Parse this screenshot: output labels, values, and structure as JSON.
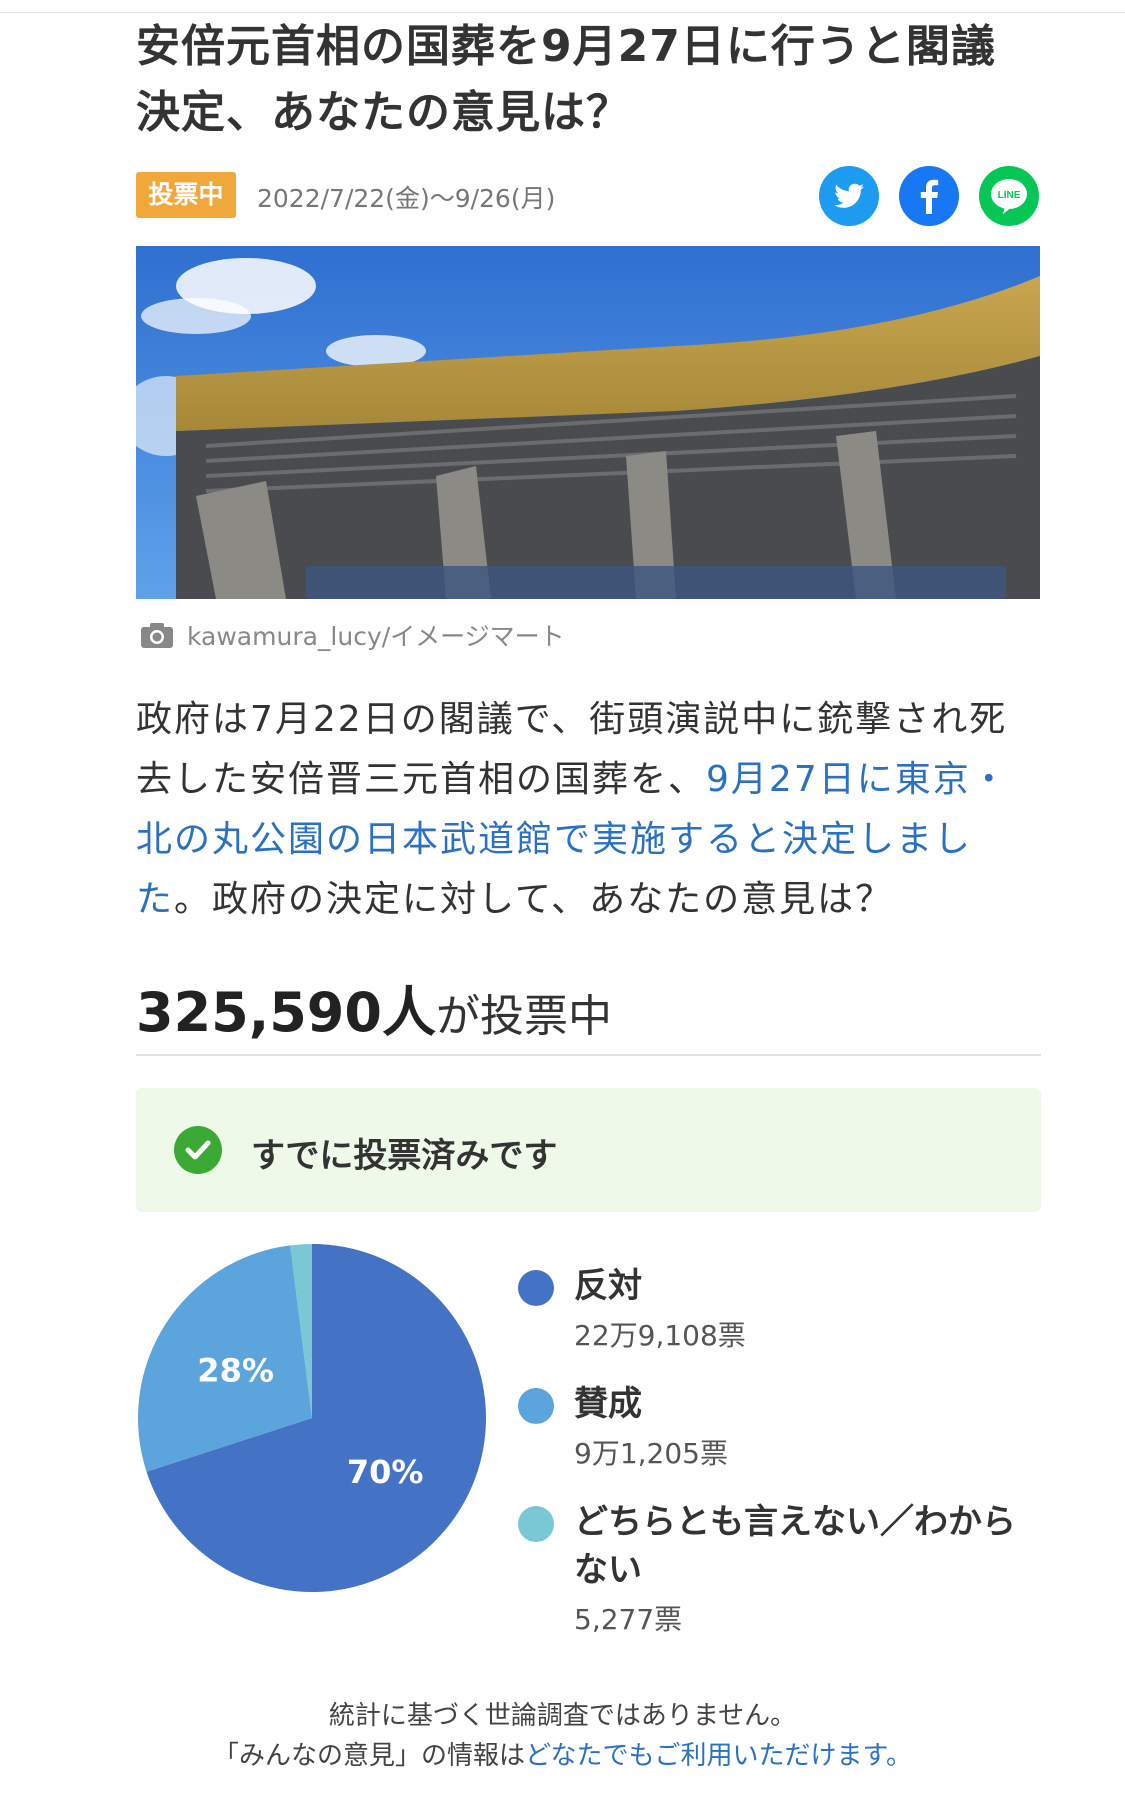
{
  "article": {
    "title": "安倍元首相の国葬を9月27日に行うと閣議決定、あなたの意見は？",
    "status_badge": "投票中",
    "date_range": "2022/7/22(金)〜9/26(月)",
    "image_credit": "kawamura_lucy/イメージマート",
    "body_part1": "政府は7月22日の閣議で、街頭演説中に銃撃され死去した安倍晋三元首相の国葬を、",
    "body_link": "9月27日に東京・北の丸公園の日本武道館で実施すると決定しました",
    "body_part2": "。政府の決定に対して、あなたの意見は？"
  },
  "share": {
    "twitter_icon": "twitter-icon",
    "facebook_icon": "facebook-icon",
    "line_icon": "line-icon",
    "line_text": "LINE"
  },
  "vote": {
    "count": "325,590人",
    "count_suffix": "が投票中",
    "voted_message": "すでに投票済みです"
  },
  "chart_data": {
    "type": "pie",
    "slices": [
      {
        "label": "反対",
        "votes": "22万9,108票",
        "percent": 70,
        "color": "#4472c4",
        "percent_label": "70%"
      },
      {
        "label": "賛成",
        "votes": "9万1,205票",
        "percent": 28,
        "color": "#5ba4dc",
        "percent_label": "28%"
      },
      {
        "label": "どちらとも言えない／わからない",
        "votes": "5,277票",
        "percent": 2,
        "color": "#7ac8d6",
        "percent_label": ""
      }
    ],
    "legend_position": "right"
  },
  "footer": {
    "disclaimer": "統計に基づく世論調査ではありません。",
    "info_prefix": "「みんなの意見」の情報は",
    "info_link": "どなたでもご利用いただけます。"
  }
}
